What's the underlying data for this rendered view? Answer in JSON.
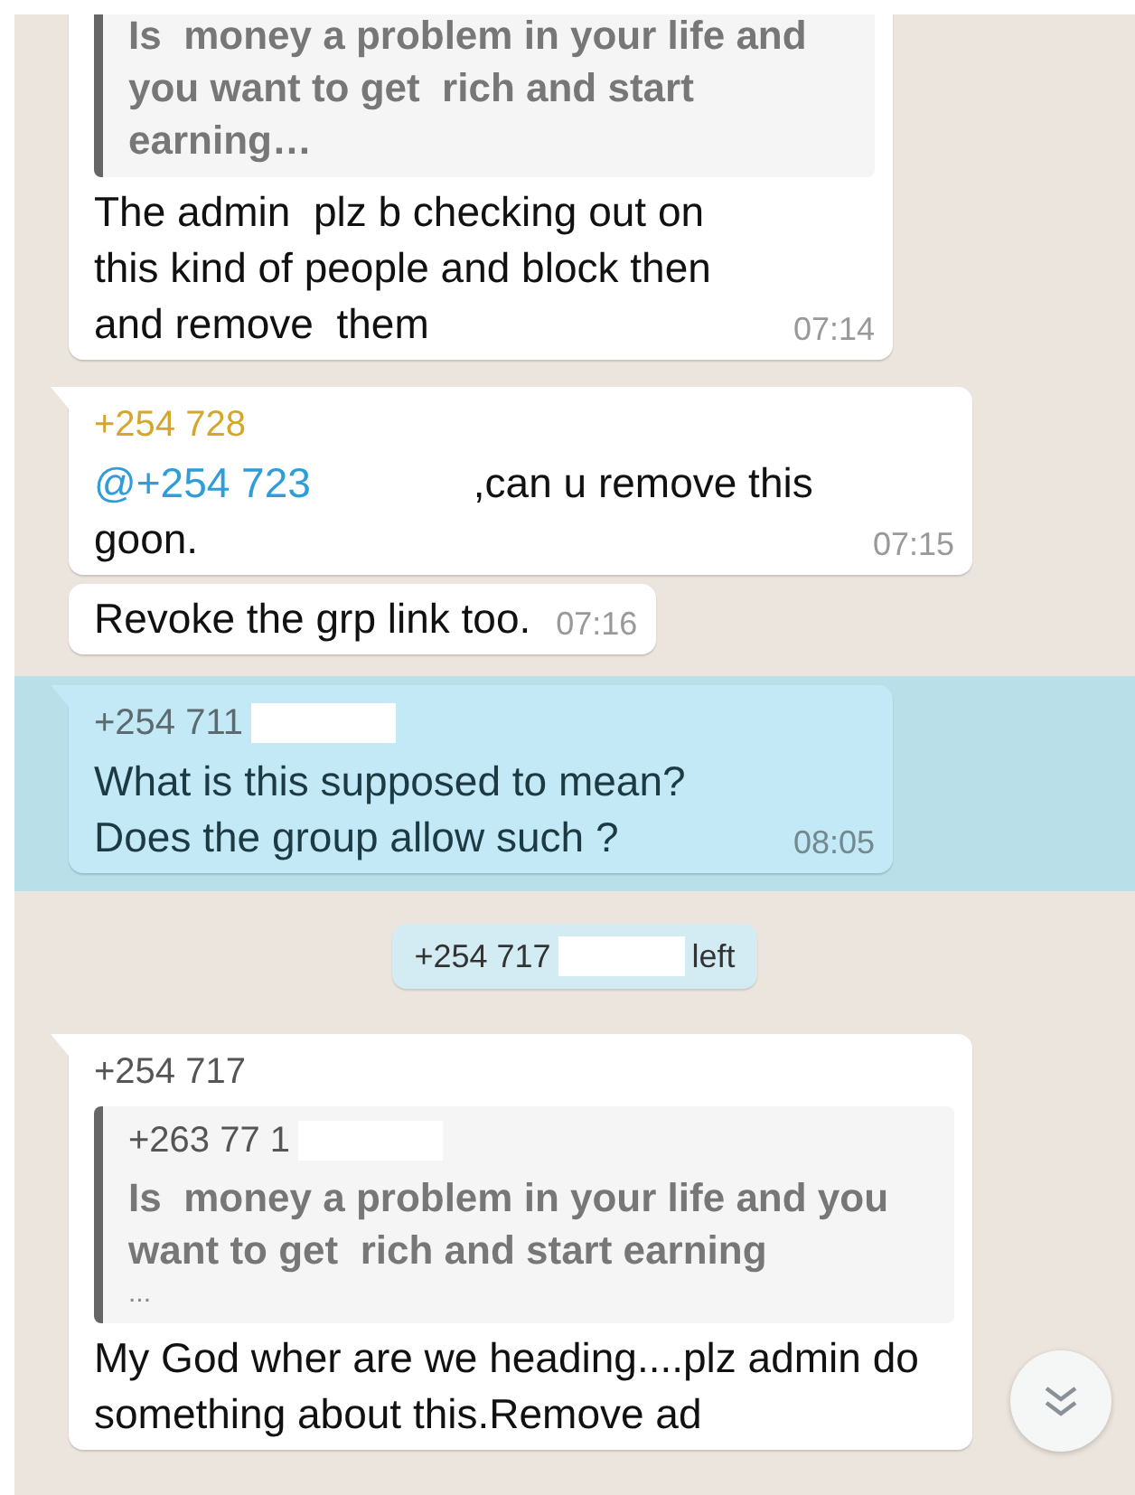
{
  "messages": [
    {
      "kind": "text",
      "selected": false,
      "tail": false,
      "quote": {
        "text": "Is  money a problem in your life and you want to get  rich and start earning…"
      },
      "text": "The admin  plz b checking out on this kind of people and block then and remove  them",
      "time": "07:14"
    },
    {
      "kind": "text",
      "selected": false,
      "tail": true,
      "sender": {
        "name": "+254 728",
        "color": "#d4a72c"
      },
      "mention": {
        "name": "@+254 723"
      },
      "text": ",can u remove this goon.",
      "time": "07:15"
    },
    {
      "kind": "text",
      "selected": false,
      "tail": false,
      "text": "Revoke the grp link too.",
      "time": "07:16"
    },
    {
      "kind": "text",
      "selected": true,
      "tail": true,
      "sender": {
        "name": "+254 711",
        "color": "#5b6b70",
        "redacted": true
      },
      "text": "What is this supposed to mean? Does the group allow such ?",
      "time": "08:05"
    },
    {
      "kind": "system",
      "selected": false,
      "before": "+254 717",
      "redacted": true,
      "after": "left"
    },
    {
      "kind": "text",
      "selected": false,
      "tail": true,
      "sender": {
        "name": "+254 717",
        "color": "#555555"
      },
      "quote": {
        "sender": "+263 77 1",
        "redacted": true,
        "text": "Is  money a problem in your life and you want to get  rich and start earning",
        "more": "..."
      },
      "text": "My God wher are we heading....plz admin do something about this.Remove ad"
    }
  ],
  "scroll_down_button": {
    "visible": true
  }
}
